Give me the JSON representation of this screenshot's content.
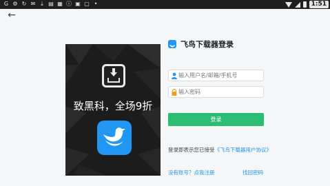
{
  "status_bar": {
    "time": "1:51",
    "left_icons": [
      "google-icon",
      "settings-icon",
      "sync-icon",
      "mail-icon",
      "download-icon",
      "notification-icon",
      "image-icon",
      "info-icon",
      "calendar-icon",
      "lock-icon",
      "dot-icon"
    ]
  },
  "nav": {
    "back_label": "←"
  },
  "banner": {
    "promo_text": "致黑科，全场9折"
  },
  "login": {
    "title": "飞鸟下载器登录",
    "username_placeholder": "输入用户名/邮箱/手机号",
    "password_placeholder": "输入密码",
    "login_button": "登录",
    "agreement_prefix": "登录即表示您已接受",
    "agreement_link": "《飞鸟下载器用户协议》",
    "register_link": "没有账号？点我注册",
    "forgot_link": "找回密码"
  },
  "colors": {
    "accent_green": "#2bbd72",
    "brand_blue": "#2196f3",
    "statusbar_bg": "#1f1f1f"
  }
}
